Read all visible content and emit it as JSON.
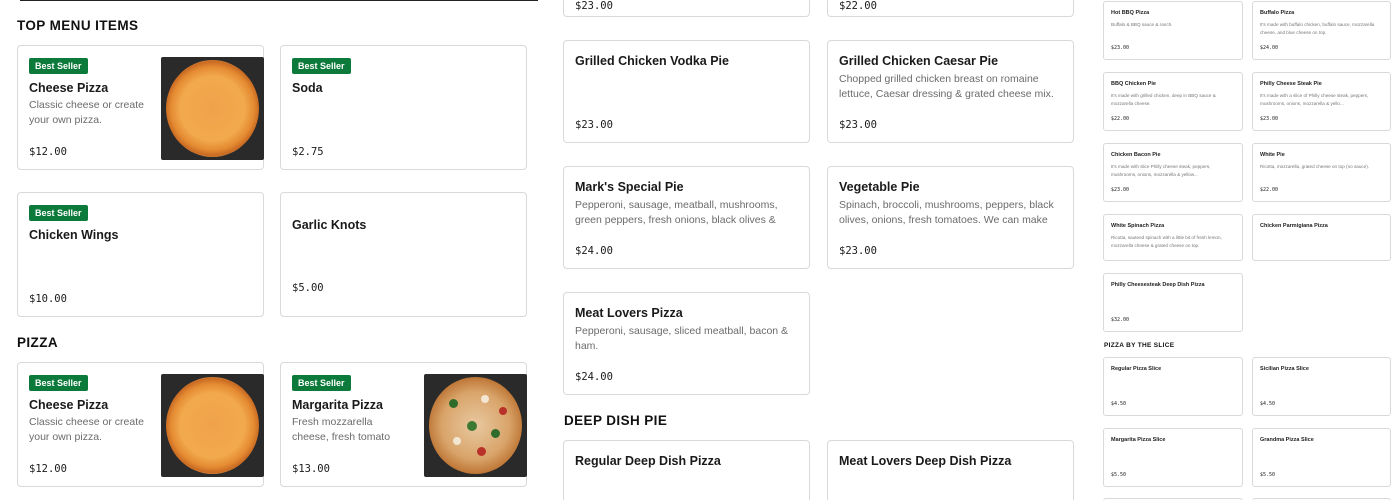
{
  "left": {
    "section_top": "TOP MENU ITEMS",
    "section_pizza": "PIZZA",
    "badge": "Best Seller",
    "top_items": [
      {
        "name": "Cheese Pizza",
        "desc": "Classic cheese or create your own pizza.",
        "price": "$12.00",
        "image": "cheese-pizza-photo"
      },
      {
        "name": "Soda",
        "desc": "",
        "price": "$2.75"
      },
      {
        "name": "Chicken Wings",
        "desc": "",
        "price": "$10.00"
      },
      {
        "name": "Garlic Knots",
        "desc": "",
        "price": "$5.00"
      }
    ],
    "pizza_items": [
      {
        "name": "Cheese Pizza",
        "desc": "Classic cheese or create your own pizza.",
        "price": "$12.00",
        "image": "cheese-pizza-photo"
      },
      {
        "name": "Margarita Pizza",
        "desc": "Fresh mozzarella cheese, fresh tomato sauce,...",
        "price": "$13.00",
        "image": "margarita-pizza-photo"
      }
    ]
  },
  "middle": {
    "top_prices": [
      "$23.00",
      "$22.00"
    ],
    "items": [
      {
        "name": "Grilled Chicken Vodka Pie",
        "desc": "",
        "price": "$23.00"
      },
      {
        "name": "Grilled Chicken Caesar Pie",
        "desc": "Chopped grilled chicken breast on romaine lettuce, Caesar dressing & grated cheese mix.",
        "price": "$23.00"
      },
      {
        "name": "Mark's Special Pie",
        "desc": "Pepperoni, sausage, meatball, mushrooms, green peppers, fresh onions, black olives & anchovies.",
        "price": "$24.00"
      },
      {
        "name": "Vegetable Pie",
        "desc": "Spinach, broccoli, mushrooms, peppers, black olives, onions, fresh tomatoes. We can make it...",
        "price": "$23.00"
      },
      {
        "name": "Meat Lovers Pizza",
        "desc": "Pepperoni, sausage, sliced meatball, bacon & ham.",
        "price": "$24.00"
      }
    ],
    "section_deep": "DEEP DISH PIE",
    "deep_items": [
      {
        "name": "Regular Deep Dish Pizza"
      },
      {
        "name": "Meat Lovers Deep Dish Pizza"
      }
    ]
  },
  "right": {
    "items": [
      {
        "name": "Hot BBQ Pizza",
        "desc": "Buffalo & BBQ sauce & ranch.",
        "price": "$23.00"
      },
      {
        "name": "Buffalo Pizza",
        "desc": "It's made with buffalo chicken, buffalo sauce, mozzarella cheese, and blue cheese on top.",
        "price": "$24.00"
      },
      {
        "name": "BBQ Chicken Pie",
        "desc": "It's made with grilled chicken, deep in BBQ sauce & mozzarella cheese.",
        "price": "$22.00"
      },
      {
        "name": "Philly Cheese Steak Pie",
        "desc": "It's made with a slice of Philly cheese steak, peppers, mushrooms, onions, mozzarella & yello...",
        "price": "$23.00"
      },
      {
        "name": "Chicken Bacon Pie",
        "desc": "It's made with slice Philly cheese steak, peppers, mushrooms, onions, mozzarella & yellow...",
        "price": "$23.00"
      },
      {
        "name": "White Pie",
        "desc": "Ricotta, mozzarella, grated cheese on top (no sauce).",
        "price": "$22.00"
      },
      {
        "name": "White Spinach Pizza",
        "desc": "Ricotta, sauteed spinach with a little bit of fresh lemon, mozzarella cheese & grated cheese on top.",
        "price": ""
      },
      {
        "name": "Chicken Parmigiana Pizza",
        "desc": "",
        "price": ""
      },
      {
        "name": "Philly Cheesesteak Deep Dish Pizza",
        "desc": "",
        "price": "$32.00"
      }
    ],
    "section_slice": "PIZZA BY THE SLICE",
    "slice_items": [
      {
        "name": "Regular Pizza Slice",
        "price": "$4.50"
      },
      {
        "name": "Sicilian Pizza Slice",
        "price": "$4.50"
      },
      {
        "name": "Margarita Pizza Slice",
        "price": "$5.50"
      },
      {
        "name": "Grandma Pizza Slice",
        "price": "$5.50"
      }
    ]
  },
  "colors": {
    "badge_green": "#0c7a3a",
    "border": "#d9d9d9",
    "desc_gray": "#6b6b6b"
  }
}
